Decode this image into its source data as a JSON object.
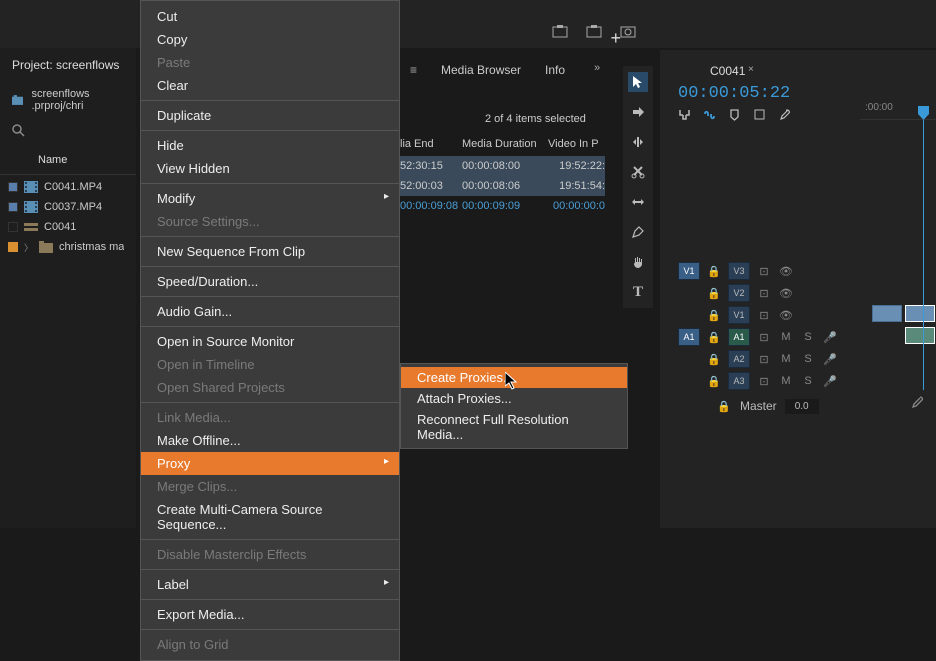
{
  "project": {
    "title": "Project: screenflows",
    "filename": "screenflows .prproj/chri",
    "name_col": "Name",
    "items": [
      {
        "checked": true,
        "label": "orange",
        "filename": "C0041.MP4"
      },
      {
        "checked": true,
        "label": "orange",
        "filename": "C0037.MP4"
      },
      {
        "checked": false,
        "label": "orange",
        "filename": "C0041",
        "is_sequence": true
      },
      {
        "checked": false,
        "label": "orange",
        "filename": "christmas ma",
        "is_bin": true
      }
    ]
  },
  "context_menu": {
    "items": [
      {
        "label": "Cut"
      },
      {
        "label": "Copy"
      },
      {
        "label": "Paste",
        "disabled": true
      },
      {
        "label": "Clear"
      },
      {
        "sep": true
      },
      {
        "label": "Duplicate"
      },
      {
        "sep": true
      },
      {
        "label": "Hide"
      },
      {
        "label": "View Hidden"
      },
      {
        "sep": true
      },
      {
        "label": "Modify",
        "submenu": true
      },
      {
        "label": "Source Settings...",
        "disabled": true
      },
      {
        "sep": true
      },
      {
        "label": "New Sequence From Clip"
      },
      {
        "sep": true
      },
      {
        "label": "Speed/Duration..."
      },
      {
        "sep": true
      },
      {
        "label": "Audio Gain..."
      },
      {
        "sep": true
      },
      {
        "label": "Open in Source Monitor"
      },
      {
        "label": "Open in Timeline",
        "disabled": true
      },
      {
        "label": "Open Shared Projects",
        "disabled": true
      },
      {
        "sep": true
      },
      {
        "label": "Link Media...",
        "disabled": true
      },
      {
        "label": "Make Offline..."
      },
      {
        "label": "Proxy",
        "submenu": true,
        "highlight": true
      },
      {
        "label": "Merge Clips...",
        "disabled": true
      },
      {
        "label": "Create Multi-Camera Source Sequence..."
      },
      {
        "sep": true
      },
      {
        "label": "Disable Masterclip Effects",
        "disabled": true
      },
      {
        "sep": true
      },
      {
        "label": "Label",
        "submenu": true
      },
      {
        "sep": true
      },
      {
        "label": "Export Media..."
      },
      {
        "sep": true
      },
      {
        "label": "Align to Grid",
        "disabled": true
      }
    ],
    "proxy_submenu": [
      {
        "label": "Create Proxies...",
        "highlight": true
      },
      {
        "label": "Attach Proxies..."
      },
      {
        "label": "Reconnect Full Resolution Media..."
      }
    ]
  },
  "media_panel": {
    "tabs": {
      "browser": "Media Browser",
      "info": "Info"
    },
    "selection_text": "2 of 4 items selected",
    "columns": {
      "end": "lia End",
      "duration": "Media Duration",
      "video_in": "Video In P"
    },
    "rows": [
      {
        "end": "52:30:15",
        "duration": "00:00:08:00",
        "video_in": "19:52:22:",
        "selected": true
      },
      {
        "end": "52:00:03",
        "duration": "00:00:08:06",
        "video_in": "19:51:54:",
        "selected": true
      },
      {
        "end": "00:00:09:08",
        "duration": "00:00:09:09",
        "video_in": "00:00:00:0",
        "selected": false,
        "blue": true
      }
    ]
  },
  "timeline": {
    "tab_name": "C0041",
    "timecode": "00:00:05:22",
    "ruler_time": ":00:00",
    "tracks": {
      "video": [
        {
          "src": "V1",
          "name": "V3"
        },
        {
          "src": "",
          "name": "V2"
        },
        {
          "src": "",
          "name": "V1"
        }
      ],
      "audio": [
        {
          "src": "A1",
          "name": "A1"
        },
        {
          "src": "",
          "name": "A2"
        },
        {
          "src": "",
          "name": "A3"
        }
      ],
      "master_label": "Master",
      "master_value": "0.0"
    }
  }
}
